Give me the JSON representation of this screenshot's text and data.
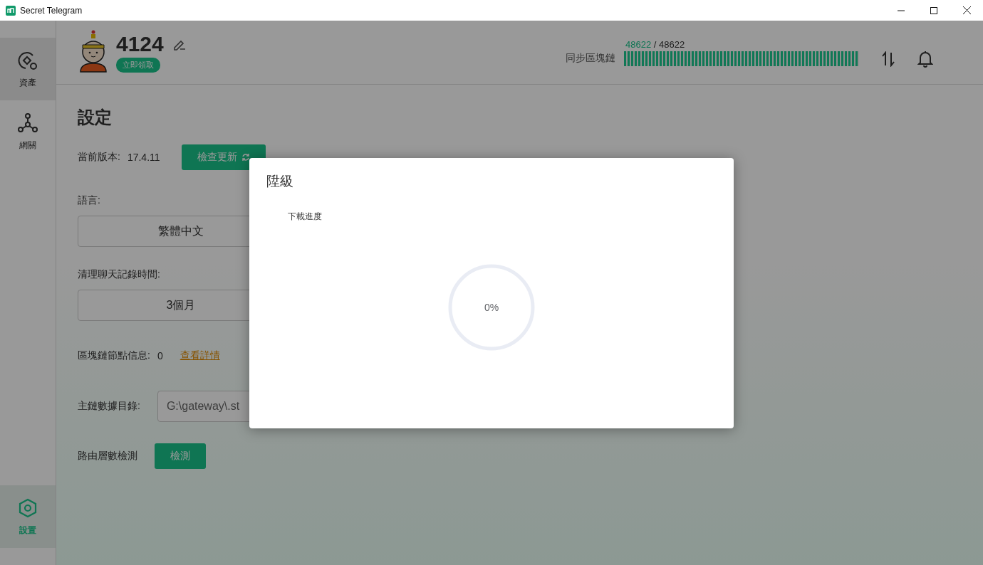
{
  "window": {
    "title": "Secret Telegram"
  },
  "sidebar": {
    "items": [
      {
        "label": "資產",
        "selected": false,
        "highlighted": true
      },
      {
        "label": "網關",
        "selected": false,
        "highlighted": false
      },
      {
        "label": "設置",
        "selected": true,
        "highlighted": false
      }
    ]
  },
  "header": {
    "username": "4124",
    "badge": "立即領取",
    "sync": {
      "current": "48622",
      "separator": "/",
      "total": "48622",
      "label": "同步區塊鏈",
      "level": 1
    }
  },
  "settings": {
    "title": "設定",
    "version": {
      "label": "當前版本:",
      "value": "17.4.11",
      "button": "檢查更新"
    },
    "language": {
      "label": "語言:",
      "value": "繁體中文"
    },
    "clear_history": {
      "label": "清理聊天記錄時間:",
      "value": "3個月"
    },
    "node_info": {
      "label": "區塊鏈節點信息:",
      "value": "0",
      "link": "查看詳情"
    },
    "data_dir": {
      "label": "主鏈數據目錄:",
      "value": "G:\\gateway\\.st"
    },
    "route_check": {
      "label": "路由層數檢測",
      "button": "檢測"
    }
  },
  "dialog": {
    "title": "陞級",
    "progress_label": "下載進度",
    "progress_text": "0%",
    "level": 0
  }
}
